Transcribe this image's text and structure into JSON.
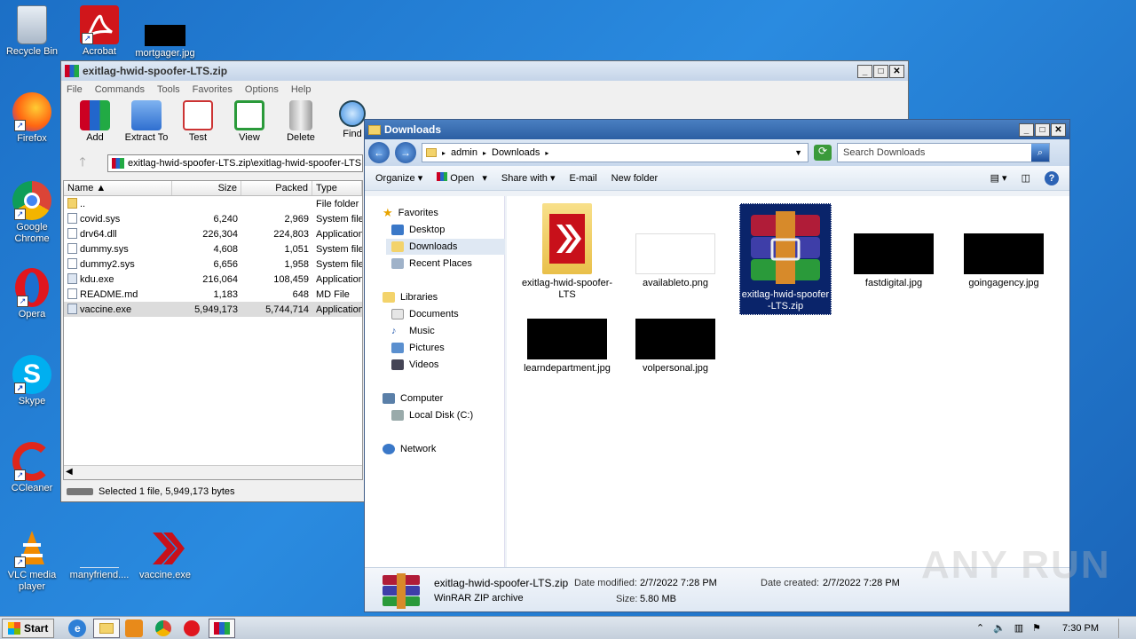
{
  "desktop": {
    "icons": [
      {
        "label": "Recycle Bin"
      },
      {
        "label": "Acrobat"
      },
      {
        "label": "mortgager.jpg"
      },
      {
        "label": "Firefox"
      },
      {
        "label": "Google Chrome"
      },
      {
        "label": "Opera"
      },
      {
        "label": "Skype"
      },
      {
        "label": "CCleaner"
      },
      {
        "label": "VLC media player"
      },
      {
        "label": "manyfriend...."
      },
      {
        "label": "vaccine.exe"
      }
    ],
    "watermark": "ANY RUN"
  },
  "winrar": {
    "title": "exitlag-hwid-spoofer-LTS.zip",
    "menu": [
      "File",
      "Commands",
      "Tools",
      "Favorites",
      "Options",
      "Help"
    ],
    "toolbar": [
      "Add",
      "Extract To",
      "Test",
      "View",
      "Delete",
      "Find"
    ],
    "path": "exitlag-hwid-spoofer-LTS.zip\\exitlag-hwid-spoofer-LTS",
    "columns": [
      "Name",
      "Size",
      "Packed",
      "Type"
    ],
    "rows": [
      {
        "name": "..",
        "size": "",
        "packed": "",
        "type": "File folder"
      },
      {
        "name": "covid.sys",
        "size": "6,240",
        "packed": "2,969",
        "type": "System file"
      },
      {
        "name": "drv64.dll",
        "size": "226,304",
        "packed": "224,803",
        "type": "Application"
      },
      {
        "name": "dummy.sys",
        "size": "4,608",
        "packed": "1,051",
        "type": "System file"
      },
      {
        "name": "dummy2.sys",
        "size": "6,656",
        "packed": "1,958",
        "type": "System file"
      },
      {
        "name": "kdu.exe",
        "size": "216,064",
        "packed": "108,459",
        "type": "Application"
      },
      {
        "name": "README.md",
        "size": "1,183",
        "packed": "648",
        "type": "MD File"
      },
      {
        "name": "vaccine.exe",
        "size": "5,949,173",
        "packed": "5,744,714",
        "type": "Application"
      }
    ],
    "status": "Selected 1 file, 5,949,173 bytes"
  },
  "explorer": {
    "title": "Downloads",
    "breadcrumb": [
      "admin",
      "Downloads"
    ],
    "search_placeholder": "Search Downloads",
    "commands": [
      "Organize",
      "Open",
      "Share with",
      "E-mail",
      "New folder"
    ],
    "nav": {
      "favorites": "Favorites",
      "fav_items": [
        "Desktop",
        "Downloads",
        "Recent Places"
      ],
      "libraries": "Libraries",
      "lib_items": [
        "Documents",
        "Music",
        "Pictures",
        "Videos"
      ],
      "computer": "Computer",
      "computer_items": [
        "Local Disk (C:)"
      ],
      "network": "Network"
    },
    "files": [
      {
        "name": "exitlag-hwid-spoofer-LTS"
      },
      {
        "name": "availableto.png"
      },
      {
        "name": "exitlag-hwid-spoofer-LTS.zip"
      },
      {
        "name": "fastdigital.jpg"
      },
      {
        "name": "goingagency.jpg"
      },
      {
        "name": "learndepartment.jpg"
      },
      {
        "name": "volpersonal.jpg"
      }
    ],
    "details": {
      "filename": "exitlag-hwid-spoofer-LTS.zip",
      "filetype": "WinRAR ZIP archive",
      "modified_label": "Date modified:",
      "modified": "2/7/2022 7:28 PM",
      "created_label": "Date created:",
      "created": "2/7/2022 7:28 PM",
      "size_label": "Size:",
      "size": "5.80 MB"
    }
  },
  "taskbar": {
    "start": "Start",
    "clock": "7:30 PM"
  }
}
